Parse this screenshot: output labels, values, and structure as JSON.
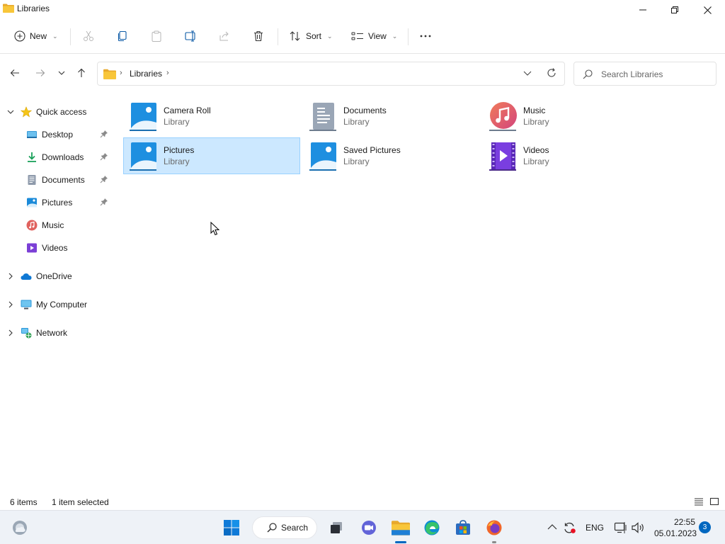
{
  "window": {
    "title": "Libraries"
  },
  "toolbar": {
    "new_label": "New",
    "sort_label": "Sort",
    "view_label": "View"
  },
  "address": {
    "breadcrumb": [
      "Libraries"
    ]
  },
  "search": {
    "placeholder": "Search Libraries"
  },
  "sidebar": {
    "quick_access": "Quick access",
    "items": [
      {
        "label": "Desktop",
        "pinned": true,
        "icon": "desktop-icon"
      },
      {
        "label": "Downloads",
        "pinned": true,
        "icon": "downloads-icon"
      },
      {
        "label": "Documents",
        "pinned": true,
        "icon": "documents-icon"
      },
      {
        "label": "Pictures",
        "pinned": true,
        "icon": "pictures-icon"
      },
      {
        "label": "Music",
        "pinned": false,
        "icon": "music-icon"
      },
      {
        "label": "Videos",
        "pinned": false,
        "icon": "videos-icon"
      }
    ],
    "roots": [
      {
        "label": "OneDrive",
        "icon": "onedrive-icon"
      },
      {
        "label": "My Computer",
        "icon": "computer-icon"
      },
      {
        "label": "Network",
        "icon": "network-icon"
      }
    ]
  },
  "libraries": [
    {
      "name": "Camera Roll",
      "type": "Library",
      "icon": "pictures-library-icon",
      "selected": false
    },
    {
      "name": "Documents",
      "type": "Library",
      "icon": "documents-library-icon",
      "selected": false
    },
    {
      "name": "Music",
      "type": "Library",
      "icon": "music-library-icon",
      "selected": false
    },
    {
      "name": "Pictures",
      "type": "Library",
      "icon": "pictures-library-icon",
      "selected": true
    },
    {
      "name": "Saved Pictures",
      "type": "Library",
      "icon": "pictures-library-icon",
      "selected": false
    },
    {
      "name": "Videos",
      "type": "Library",
      "icon": "videos-library-icon",
      "selected": false
    }
  ],
  "status": {
    "items_count": "6 items",
    "selection": "1 item selected"
  },
  "taskbar": {
    "search_label": "Search",
    "language": "ENG",
    "time": "22:55",
    "date": "05.01.2023",
    "notifications": "3"
  },
  "colors": {
    "accent": "#0067c0",
    "selection_bg": "#cce8ff",
    "selection_border": "#99d1ff",
    "folder_yellow": "#f8c63a"
  }
}
